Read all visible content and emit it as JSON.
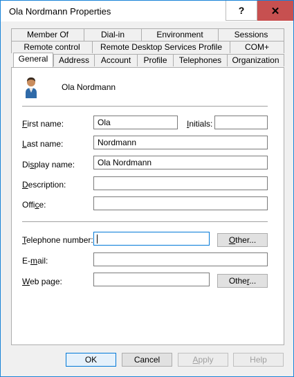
{
  "window": {
    "title": "Ola Nordmann Properties",
    "help_label": "?",
    "close_label": "✕"
  },
  "tabs": {
    "row1": [
      "Member Of",
      "Dial-in",
      "Environment",
      "Sessions"
    ],
    "row2": [
      "Remote control",
      "Remote Desktop Services Profile",
      "COM+"
    ],
    "row3": [
      "General",
      "Address",
      "Account",
      "Profile",
      "Telephones",
      "Organization"
    ],
    "active": "General"
  },
  "general": {
    "user_name": "Ola Nordmann",
    "first_name": {
      "label_u": "F",
      "label_rest": "irst name:",
      "value": "Ola"
    },
    "initials": {
      "label_u": "I",
      "label_rest": "nitials:",
      "value": ""
    },
    "last_name": {
      "label_u": "L",
      "label_rest": "ast name:",
      "value": "Nordmann"
    },
    "display_name": {
      "label_pre": "Di",
      "label_u": "s",
      "label_rest": "play name:",
      "value": "Ola Nordmann"
    },
    "description": {
      "label_u": "D",
      "label_rest": "escription:",
      "value": ""
    },
    "office": {
      "label_pre": "Offi",
      "label_u": "c",
      "label_rest": "e:",
      "value": ""
    },
    "telephone": {
      "label_u": "T",
      "label_rest": "elephone number:",
      "value": ""
    },
    "email": {
      "label_pre": "E-",
      "label_u": "m",
      "label_rest": "ail:",
      "value": ""
    },
    "web_page": {
      "label_u": "W",
      "label_rest": "eb page:",
      "value": ""
    },
    "other_tel": {
      "label_u": "O",
      "label_rest": "ther..."
    },
    "other_web": {
      "label_pre": "Othe",
      "label_u": "r",
      "label_rest": "..."
    }
  },
  "buttons": {
    "ok": "OK",
    "cancel": "Cancel",
    "apply_u": "A",
    "apply_rest": "pply",
    "help": "Help"
  }
}
